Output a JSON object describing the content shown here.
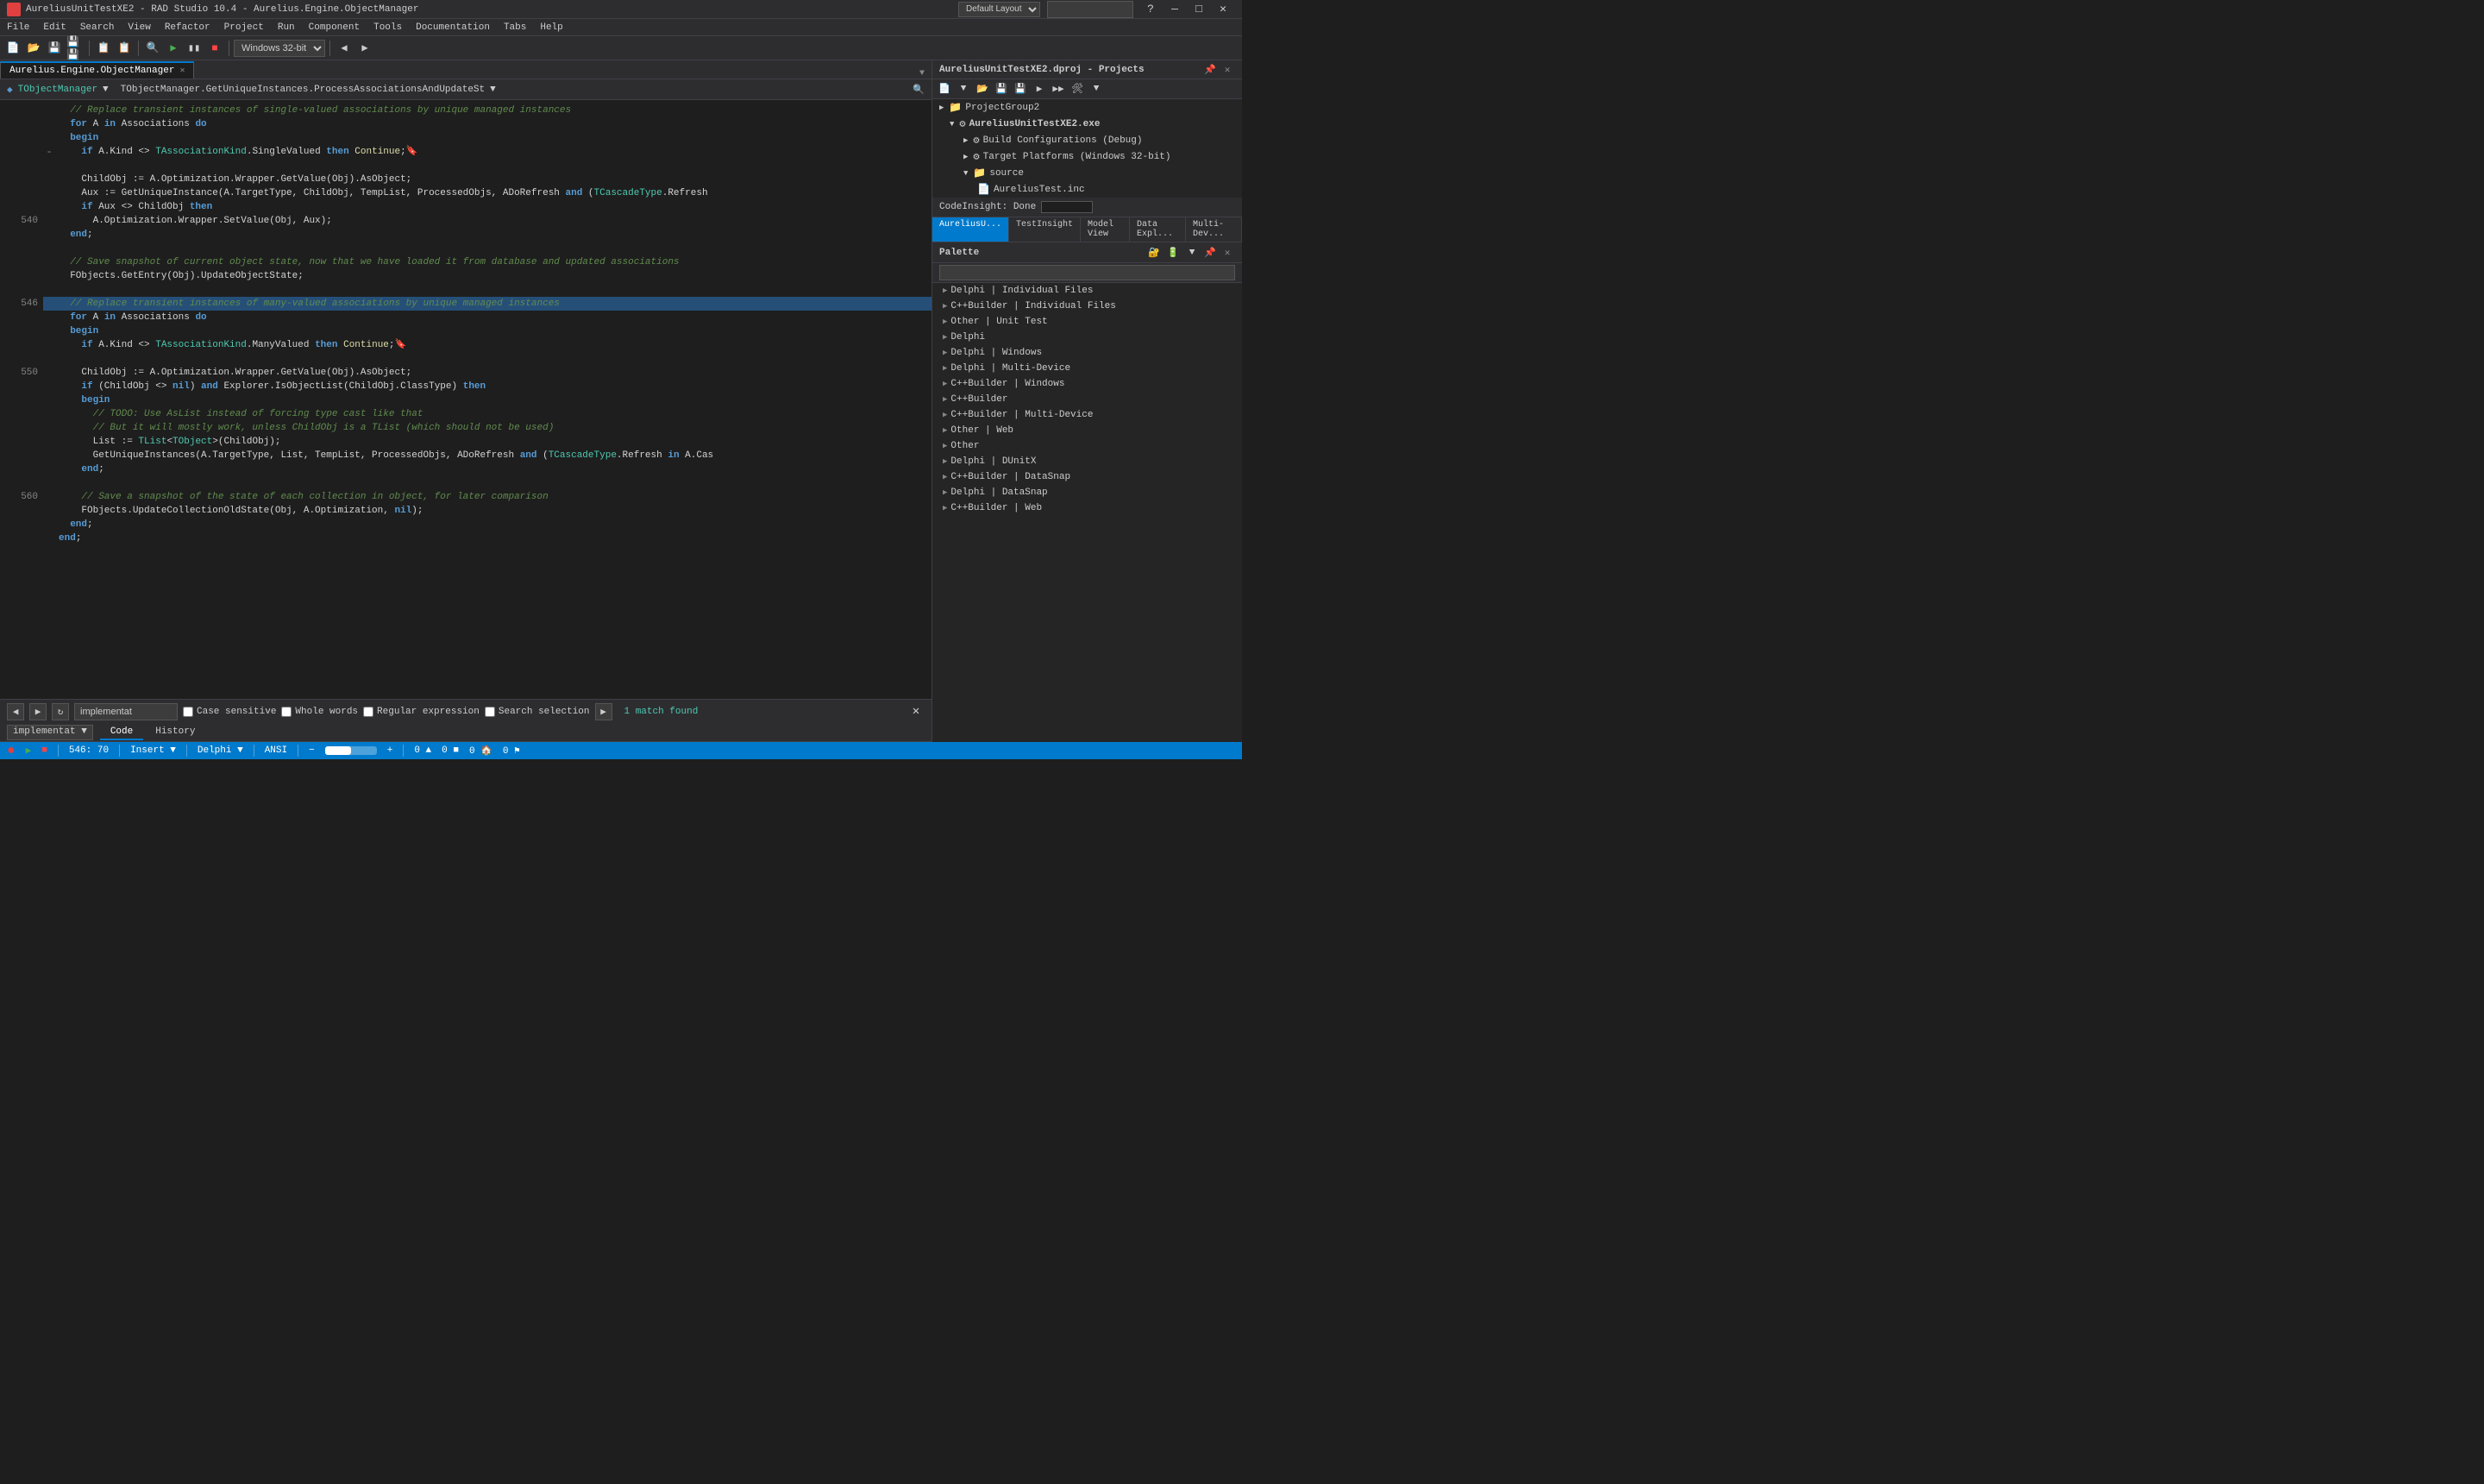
{
  "titleBar": {
    "appIcon": "rad-icon",
    "title": "AureliusUnitTestXE2 - RAD Studio 10.4 - Aurelius.Engine.ObjectManager",
    "layoutLabel": "Default Layout",
    "windowControls": [
      "minimize",
      "maximize",
      "close"
    ]
  },
  "menuBar": {
    "items": [
      "File",
      "Edit",
      "Search",
      "View",
      "Refactor",
      "Project",
      "Run",
      "Component",
      "Tools",
      "Documentation",
      "Tabs",
      "Help"
    ]
  },
  "rightPanel": {
    "projectsTitle": "AureliusUnitTestXE2.dproj - Projects",
    "codeInsight": "CodeInsight: Done",
    "tabs": [
      "AureliusU...",
      "TestInsight",
      "Model View",
      "Data Expl...",
      "Multi-Dev..."
    ],
    "activeTab": "AureliusU...",
    "tree": [
      {
        "label": "ProjectGroup2",
        "level": 0,
        "icon": "📁",
        "expanded": false
      },
      {
        "label": "AureliusUnitTestXE2.exe",
        "level": 1,
        "icon": "⚙️",
        "expanded": true
      },
      {
        "label": "Build Configurations (Debug)",
        "level": 2,
        "icon": "⚙️",
        "expanded": false
      },
      {
        "label": "Target Platforms (Windows 32-bit)",
        "level": 2,
        "icon": "⚙️",
        "expanded": false
      },
      {
        "label": "source",
        "level": 2,
        "icon": "📁",
        "expanded": true
      },
      {
        "label": "AureliusTest.inc",
        "level": 3,
        "icon": "📄",
        "expanded": false
      }
    ],
    "paletteTitle": "Palette",
    "paletteItems": [
      "Delphi | Individual Files",
      "C++Builder | Individual Files",
      "Other | Unit Test",
      "Delphi",
      "Delphi | Windows",
      "Delphi | Multi-Device",
      "C++Builder | Windows",
      "C++Builder",
      "C++Builder | Multi-Device",
      "Other | Web",
      "Other",
      "Delphi | DUnitX",
      "C++Builder | DataSnap",
      "Delphi | DataSnap",
      "C++Builder | Web"
    ]
  },
  "editorTabs": [
    {
      "label": "Aurelius.Engine.ObjectManager",
      "active": true,
      "closeable": true
    }
  ],
  "breadcrumb": {
    "left": "TObjectManager",
    "right": "TObjectManager.GetUniqueInstances.ProcessAssociationsAndUpdateSt"
  },
  "codeLines": [
    {
      "num": "",
      "minus": "",
      "text": "  // Replace transient instances of single-valued associations by unique managed instances",
      "type": "comment",
      "hl": false
    },
    {
      "num": "",
      "minus": "",
      "text": "  for A in Associations do",
      "type": "plain",
      "hl": false
    },
    {
      "num": "",
      "minus": "",
      "text": "  begin",
      "type": "kw",
      "hl": false
    },
    {
      "num": "",
      "minus": "-",
      "text": "    if A.Kind <> TAssociationKind.SingleValued then Continue;🔖",
      "type": "plain",
      "hl": false
    },
    {
      "num": "",
      "minus": "",
      "text": "",
      "type": "plain",
      "hl": false
    },
    {
      "num": "",
      "minus": "",
      "text": "    ChildObj := A.Optimization.Wrapper.GetValue(Obj).AsObject;",
      "type": "plain",
      "hl": false
    },
    {
      "num": "",
      "minus": "",
      "text": "    Aux := GetUniqueInstance(A.TargetType, ChildObj, TempList, ProcessedObjs, ADoRefresh and (TCascadeType.Refresh",
      "type": "plain",
      "hl": false
    },
    {
      "num": "",
      "minus": "",
      "text": "    if Aux <> ChildObj then",
      "type": "plain",
      "hl": false
    },
    {
      "num": "540",
      "minus": "",
      "text": "      A.Optimization.Wrapper.SetValue(Obj, Aux);",
      "type": "plain",
      "hl": false
    },
    {
      "num": "",
      "minus": "",
      "text": "  end;",
      "type": "plain",
      "hl": false
    },
    {
      "num": "",
      "minus": "",
      "text": "",
      "type": "plain",
      "hl": false
    },
    {
      "num": "",
      "minus": "",
      "text": "  // Save snapshot of current object state, now that we have loaded it from database and updated associations",
      "type": "comment",
      "hl": false
    },
    {
      "num": "",
      "minus": "",
      "text": "  FObjects.GetEntry(Obj).UpdateObjectState;",
      "type": "plain",
      "hl": false
    },
    {
      "num": "",
      "minus": "",
      "text": "",
      "type": "plain",
      "hl": false
    },
    {
      "num": "546",
      "minus": "",
      "text": "  // Replace transient instances of many-valued associations by unique managed instances",
      "type": "comment",
      "hl": true
    },
    {
      "num": "",
      "minus": "",
      "text": "  for A in Associations do",
      "type": "plain",
      "hl": false
    },
    {
      "num": "",
      "minus": "",
      "text": "  begin",
      "type": "kw",
      "hl": false
    },
    {
      "num": "",
      "minus": "",
      "text": "    if A.Kind <> TAssociationKind.ManyValued then Continue;🔖",
      "type": "plain",
      "hl": false
    },
    {
      "num": "",
      "minus": "",
      "text": "",
      "type": "plain",
      "hl": false
    },
    {
      "num": "550",
      "minus": "",
      "text": "    ChildObj := A.Optimization.Wrapper.GetValue(Obj).AsObject;",
      "type": "plain",
      "hl": false
    },
    {
      "num": "",
      "minus": "",
      "text": "    if (ChildObj <> nil) and Explorer.IsObjectList(ChildObj.ClassType) then",
      "type": "plain",
      "hl": false
    },
    {
      "num": "",
      "minus": "",
      "text": "    begin",
      "type": "kw",
      "hl": false
    },
    {
      "num": "",
      "minus": "",
      "text": "      // TODO: Use AsList instead of forcing type cast like that",
      "type": "comment",
      "hl": false
    },
    {
      "num": "",
      "minus": "",
      "text": "      // But it will mostly work, unless ChildObj is a TList (which should not be used)",
      "type": "comment",
      "hl": false
    },
    {
      "num": "",
      "minus": "",
      "text": "      List := TList<TObject>(ChildObj);",
      "type": "plain",
      "hl": false
    },
    {
      "num": "",
      "minus": "",
      "text": "      GetUniqueInstances(A.TargetType, List, TempList, ProcessedObjs, ADoRefresh and (TCascadeType.Refresh in A.Cas",
      "type": "plain",
      "hl": false
    },
    {
      "num": "",
      "minus": "",
      "text": "    end;",
      "type": "plain",
      "hl": false
    },
    {
      "num": "",
      "minus": "",
      "text": "",
      "type": "plain",
      "hl": false
    },
    {
      "num": "560",
      "minus": "",
      "text": "    // Save a snapshot of the state of each collection in object, for later comparison",
      "type": "comment",
      "hl": false
    },
    {
      "num": "",
      "minus": "",
      "text": "    FObjects.UpdateCollectionOldState(Obj, A.Optimization, nil);",
      "type": "plain",
      "hl": false
    },
    {
      "num": "",
      "minus": "",
      "text": "  end;",
      "type": "plain",
      "hl": false
    },
    {
      "num": "",
      "minus": "",
      "text": "end;",
      "type": "plain",
      "hl": false
    }
  ],
  "searchBar": {
    "placeholder": "implementat",
    "value": "implementat",
    "caseSensitive": "Case sensitive",
    "wholeWords": "Whole words",
    "regularExpression": "Regular expression",
    "searchSelection": "Search selection",
    "matchCount": "1 match found",
    "navButtons": [
      "◀",
      "▶",
      "↺",
      "✕"
    ]
  },
  "bottomTabs": [
    "Code",
    "History"
  ],
  "activeBottomTab": "Code",
  "statusBar": {
    "recording": "●",
    "runBtn": "▶",
    "stopBtn": "■",
    "line": "546: 70",
    "insertMode": "Insert",
    "language": "Delphi",
    "encoding": "ANSI",
    "zoomMinus": "-",
    "zoomPlus": "+",
    "zoomLevel": "",
    "indicators": [
      "0",
      "▲",
      "0",
      "🏠",
      "0",
      "⚑",
      "0"
    ]
  },
  "toolbar": {
    "windowsPlatform": "Windows 32-bit"
  }
}
